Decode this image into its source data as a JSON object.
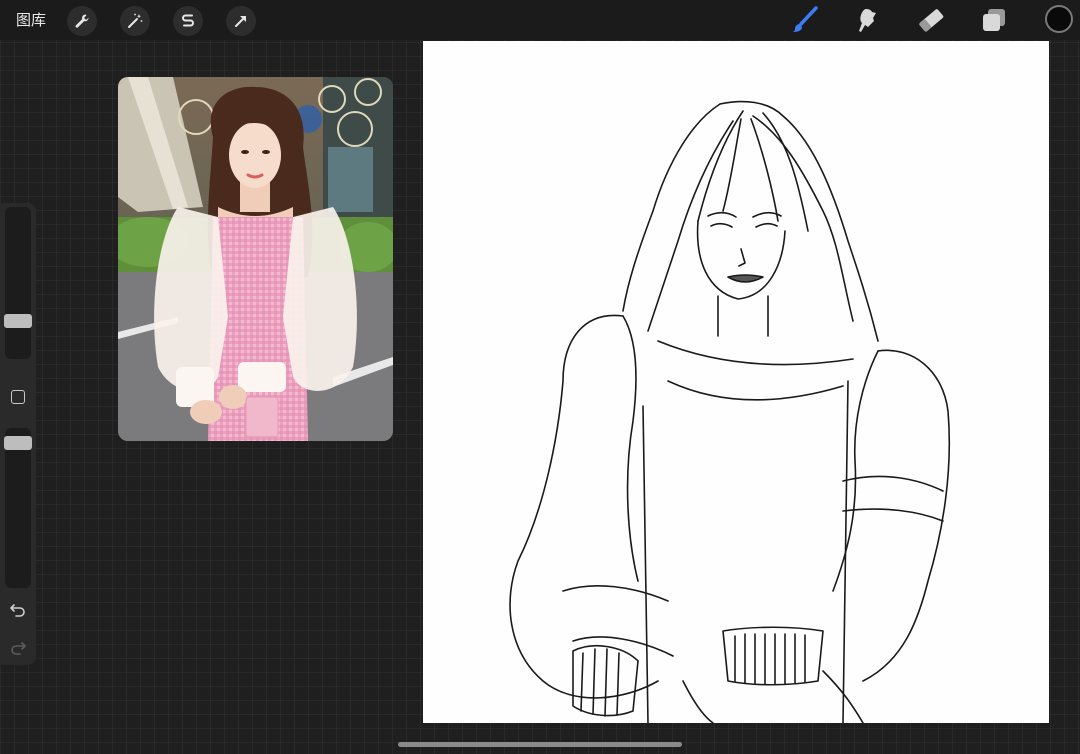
{
  "app": {
    "gallery_label": "图库"
  },
  "toolbar_left": [
    {
      "name": "actions-wrench-icon"
    },
    {
      "name": "adjustments-magic-wand-icon"
    },
    {
      "name": "selection-s-icon"
    },
    {
      "name": "transform-arrow-icon"
    }
  ],
  "toolbar_right": [
    {
      "name": "brush-icon",
      "active": true
    },
    {
      "name": "smudge-icon",
      "active": false
    },
    {
      "name": "eraser-icon",
      "active": false
    },
    {
      "name": "layers-icon",
      "active": false
    }
  ],
  "colors": {
    "active_tool": "#3d7cf2",
    "current_color": "#0a0a0a",
    "canvas": "#fefefe",
    "background": "#1f1f1f"
  },
  "sidebar": {
    "brush_size_level": 0.28,
    "opacity_level": 0.9,
    "undo_icon": "undo-icon",
    "redo_icon": "redo-icon"
  }
}
